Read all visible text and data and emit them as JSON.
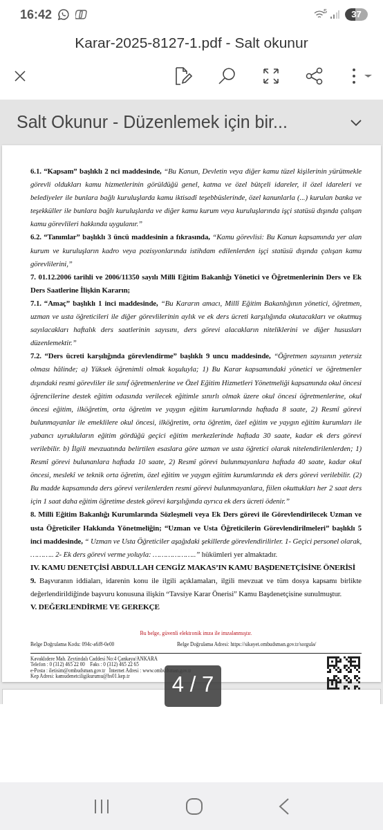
{
  "status_bar": {
    "time": "16:42",
    "network": "5",
    "battery": "37"
  },
  "window": {
    "title": "Karar-2025-8127-1.pdf - Salt okunur"
  },
  "banner": {
    "text": "Salt Okunur - Düzenlemek için bir...",
    "expanded": false
  },
  "document": {
    "paragraphs": [
      {
        "kind": "para",
        "text": "**6.1. “Kapsam” başlıklı 2 nci maddesinde,** *“Bu Kanun, Devletin veya diğer kamu tüzel kişilerinin yürütmekle görevli oldukları kamu hizmetlerinin görüldüğü genel, katma ve özel bütçeli idareler, il özel idareleri ve belediyeler ile bunlara bağlı kuruluşlarda kamu iktisadî teşebbüslerinde, özel kanunlarla (...) kurulan banka ve teşekküller ile bunlara bağlı kuruluşlarda ve diğer kamu kurum veya kuruluşlarında işçi statüsü dışında çalışan kamu görevlileri hakkında uygulanır.”*"
      },
      {
        "kind": "para",
        "text": "**6.2. “Tanımlar” başlıklı 3 üncü maddesinin a fıkrasında,** *“Kamu görevlisi: Bu Kanun kapsamında yer alan kurum ve kuruluşların kadro veya pozisyonlarında istihdam edilenlerden işçi statüsü dışında çalışan kamu görevlilerini,”*"
      },
      {
        "kind": "bold",
        "text": "7. 01.12.2006 tarihli ve 2006/11350 sayılı Milli Eğitim Bakanlığı Yönetici ve Öğretmenlerinin Ders ve Ek Ders Saatlerine İlişkin Kararın;"
      },
      {
        "kind": "para",
        "text": "**7.1. “Amaç” başlıklı 1 inci maddesinde,** *“Bu Kararın amacı, Millî Eğitim Bakanlığının yönetici, öğretmen, uzman ve usta öğreticileri ile diğer görevlilerinin aylık ve ek ders ücreti karşılığında okutacakları ve okutmuş sayılacakları haftalık ders saatlerinin sayısını, ders görevi alacakların niteliklerini ve diğer hususları düzenlemektir.”*"
      },
      {
        "kind": "para",
        "text": "**7.2. “Ders ücreti karşılığında görevlendirme” başlıklı 9 uncu maddesinde,** *“Öğretmen sayısının yetersiz olması hâlinde; a) Yüksek öğrenimli olmak koşuluyla; 1) Bu Karar kapsamındaki yönetici ve öğretmenler dışındaki resmi görevliler ile sınıf öğretmenlerine ve Özel Eğitim Hizmetleri Yönetmeliği kapsamında okul öncesi öğrencilerine destek eğitim odasında verilecek eğitimle sınırlı olmak üzere okul öncesi öğretmenlerine, okul öncesi eğitim, ilköğretim, orta öğretim ve yaygın eğitim kurumlarında haftada 8 saate, 2) Resmî görevi bulunmayanlar ile emeklilere okul öncesi, ilköğretim, orta öğretim, özel eğitim ve yaygın eğitim kurumları ile yabancı uyrukluların eğitim gördüğü geçici eğitim merkezlerinde haftada 30 saate, kadar ek ders görevi verilebilir. b) İlgili mevzuatında belirtilen esaslara göre uzman ve usta öğretici olarak nitelendirilenlerden; 1) Resmî görevi bulunanlara haftada 10 saate, 2) Resmî görevi bulunmayanlara haftada 40 saate, kadar okul öncesi, meslekî ve teknik orta öğretim, özel eğitim ve yaygın eğitim kurumlarında ek ders görevi verilebilir. (2) Bu madde kapsamında ders görevi verilenlerden resmi görevi bulunmayanlara, fiilen okuttukları her 2 saat ders için 1 saat daha eğitim öğretime destek görevi karşılığında ayrıca ek ders ücreti ödenir.”*"
      },
      {
        "kind": "para",
        "text": "**8. Milli Eğitim Bakanlığı Kurumlarında Sözleşmeli veya Ek Ders görevi ile Görevlendirilecek Uzman ve usta Öğreticiler Hakkında Yönetmeliğin; “Uzman ve Usta Öğreticilerin Görevlendirilmeleri” başlıklı 5 inci maddesinde,** *“ Uzman ve Usta Öğreticiler aşağıdaki şekillerde görevlendirilirler. 1- Geçici personel olarak, ……….. 2- Ek ders görevi verme yoluyla: ………………..”* hükümleri yer almaktadır."
      },
      {
        "kind": "heading",
        "text": "IV. KAMU DENETÇİSİ ABDULLAH CENGİZ MAKAS’IN KAMU BAŞDENETÇİSİNE ÖNERİSİ"
      },
      {
        "kind": "para",
        "text": "**9.** Başvuranın iddiaları, idarenin konu ile ilgili açıklamaları, ilgili mevzuat ve tüm dosya kapsamı birlikte değerlendirildiğinde başvuru konusuna ilişkin “Tavsiye Karar Önerisi” Kamu Başdenetçisine sunulmuştur."
      },
      {
        "kind": "heading",
        "text": "V. DEĞERLENDİRME VE GEREKÇE"
      }
    ],
    "signature_note": "Bu belge, güvenli elektronik imza ile imzalanmıştır.",
    "verification": [
      "Belge Doğrulama Kodu: 094c-a6f8-0e00",
      "Belge Doğrulama Adresi: https://sikayet.ombudsman.gov.tr/sorgula/"
    ],
    "contact_lines": [
      "Kavaklıdere Mah. Zeytindalı Caddesi No:4 Çankaya/ANKARA",
      "Telefon : 0 (312) 465 22 00    Faks : 0 (312) 465 22 65",
      "e-Posta : iletisim@ombudsman.gov.tr   İnternet Adresi : www.ombudsman.gov.tr",
      "Kep Adresi: kamudenetciligikurumu@hs01.kep.tr"
    ]
  },
  "page_indicator": "4 / 7"
}
